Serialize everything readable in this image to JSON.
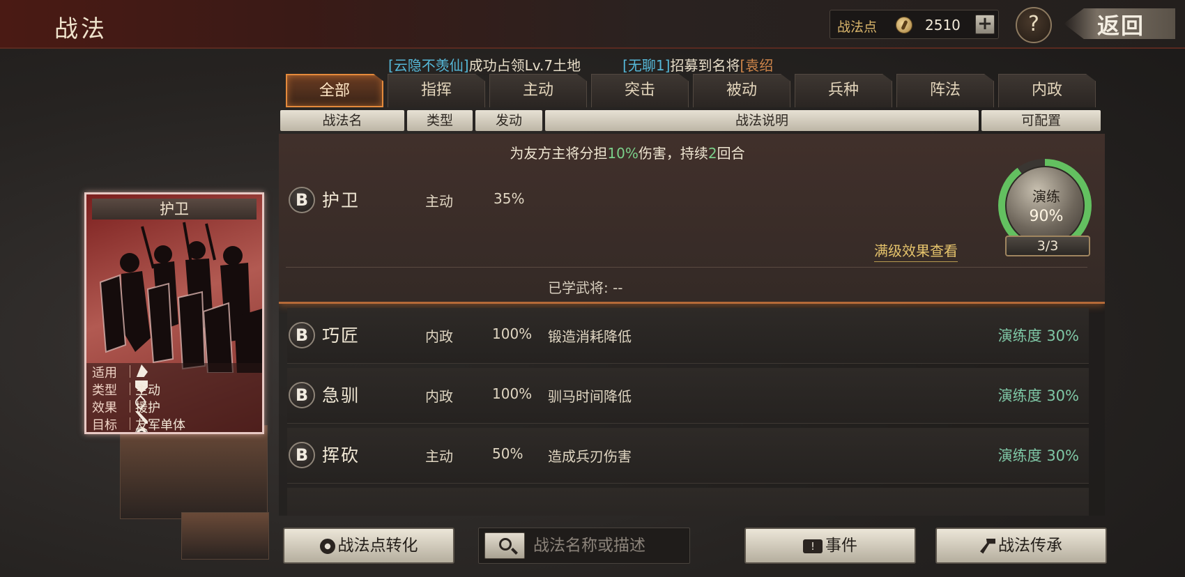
{
  "header": {
    "title": "战法",
    "points_label": "战法点",
    "points_value": "2510",
    "plus": "+",
    "help": "?",
    "back": "返回"
  },
  "ticker": {
    "msg1_name": "[云隐不羡仙]",
    "msg1_text": "成功占领Lv.7土地",
    "msg2_name": "[无聊1]",
    "msg2_text": "招募到名将",
    "msg2_tail": "[袁绍"
  },
  "tabs": [
    {
      "label": "全部",
      "active": true
    },
    {
      "label": "指挥"
    },
    {
      "label": "主动"
    },
    {
      "label": "突击"
    },
    {
      "label": "被动"
    },
    {
      "label": "兵种"
    },
    {
      "label": "阵法"
    },
    {
      "label": "内政"
    }
  ],
  "columns": {
    "name": "战法名",
    "type": "类型",
    "trigger": "发动",
    "desc": "战法说明",
    "config": "可配置"
  },
  "selected": {
    "grade": "B",
    "name": "护卫",
    "type": "主动",
    "rate": "35%",
    "desc_a": "为友方主将分担",
    "desc_hl1": "10%",
    "desc_b": "伤害，持续",
    "desc_hl2": "2",
    "desc_c": "回合",
    "max_link": "满级效果查看",
    "learned": "已学武将:  --",
    "drill_label": "演练",
    "drill_pct": "90%",
    "drill_progress": 0.9,
    "drill_count": "3/3"
  },
  "rows": [
    {
      "grade": "B",
      "name": "巧匠",
      "type": "内政",
      "rate": "100%",
      "desc": "锻造消耗降低",
      "prof": "演练度 30%"
    },
    {
      "grade": "B",
      "name": "急驯",
      "type": "内政",
      "rate": "100%",
      "desc": "驯马时间降低",
      "prof": "演练度 30%"
    },
    {
      "grade": "B",
      "name": "挥砍",
      "type": "主动",
      "rate": "50%",
      "desc": "造成兵刃伤害",
      "prof": "演练度 30%"
    }
  ],
  "card": {
    "title": "护卫",
    "apply_key": "适用",
    "type_key": "类型",
    "type_val": "主动",
    "effect_key": "效果",
    "effect_val": "援护",
    "target_key": "目标",
    "target_val": "友军单体",
    "arm_icons": [
      "cavalry-icon",
      "shield-icon",
      "bow-icon",
      "spear-icon",
      "siege-icon"
    ]
  },
  "buttons": {
    "convert": "战法点转化",
    "event": "事件",
    "inherit": "战法传承"
  },
  "search": {
    "placeholder": "战法名称或描述"
  },
  "colors": {
    "accent_orange": "#e48a3c",
    "prof_green": "#7fc8a6",
    "highlight_green": "#7bd08a",
    "ticker_blue": "#56b8d8"
  }
}
